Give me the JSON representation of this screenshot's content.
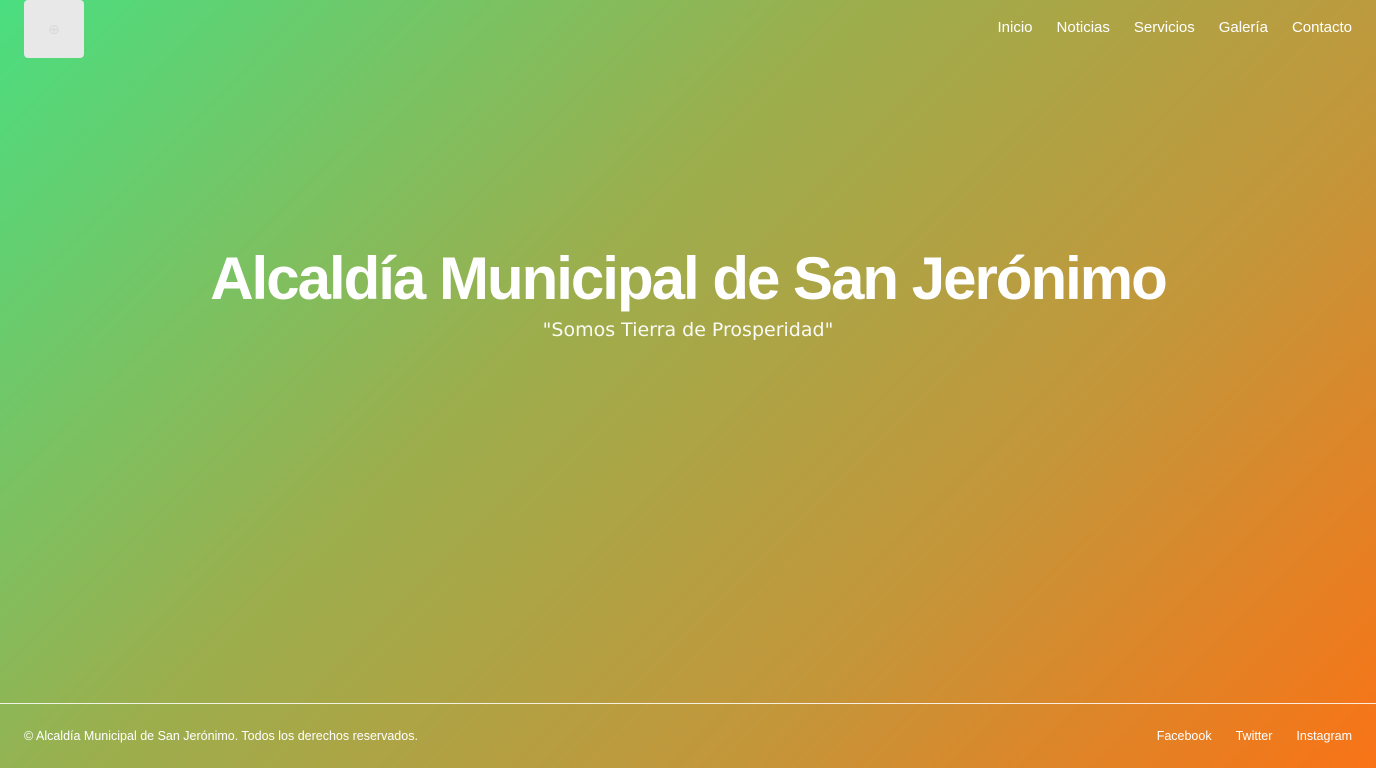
{
  "header": {
    "logo_icon": "logo-placeholder-icon",
    "nav": [
      {
        "label": "Inicio"
      },
      {
        "label": "Noticias"
      },
      {
        "label": "Servicios"
      },
      {
        "label": "Galería"
      },
      {
        "label": "Contacto"
      }
    ]
  },
  "hero": {
    "title": "Alcaldía Municipal de San Jerónimo",
    "slogan": "\"Somos Tierra de Prosperidad\""
  },
  "footer": {
    "copyright": "© Alcaldía Municipal de San Jerónimo. Todos los derechos reservados.",
    "social": [
      {
        "label": "Facebook"
      },
      {
        "label": "Twitter"
      },
      {
        "label": "Instagram"
      }
    ]
  },
  "colors": {
    "gradient_start": "#4ade80",
    "gradient_end": "#f97316",
    "text": "#ffffff",
    "logo_bg": "#e8e8e8"
  }
}
